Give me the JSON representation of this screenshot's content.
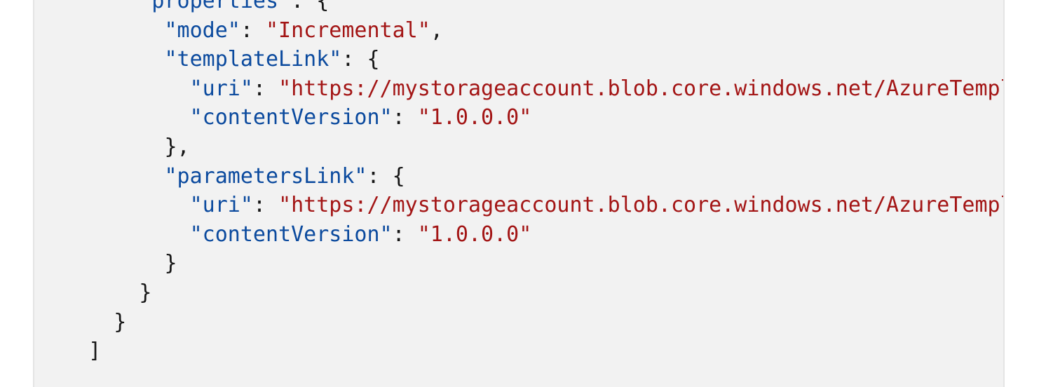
{
  "code": {
    "language": "json",
    "lines": [
      {
        "indent": "      ",
        "tokens": [
          {
            "t": "k",
            "v": "\"properties\""
          },
          {
            "t": "p",
            "v": ": {"
          }
        ]
      },
      {
        "indent": "        ",
        "tokens": [
          {
            "t": "k",
            "v": "\"mode\""
          },
          {
            "t": "p",
            "v": ": "
          },
          {
            "t": "s",
            "v": "\"Incremental\""
          },
          {
            "t": "p",
            "v": ","
          }
        ]
      },
      {
        "indent": "        ",
        "tokens": [
          {
            "t": "k",
            "v": "\"templateLink\""
          },
          {
            "t": "p",
            "v": ": {"
          }
        ]
      },
      {
        "indent": "          ",
        "tokens": [
          {
            "t": "k",
            "v": "\"uri\""
          },
          {
            "t": "p",
            "v": ": "
          },
          {
            "t": "s",
            "v": "\"https://mystorageaccount.blob.core.windows.net/AzureTempl"
          }
        ]
      },
      {
        "indent": "          ",
        "tokens": [
          {
            "t": "k",
            "v": "\"contentVersion\""
          },
          {
            "t": "p",
            "v": ": "
          },
          {
            "t": "s",
            "v": "\"1.0.0.0\""
          }
        ]
      },
      {
        "indent": "        ",
        "tokens": [
          {
            "t": "p",
            "v": "},"
          }
        ]
      },
      {
        "indent": "        ",
        "tokens": [
          {
            "t": "k",
            "v": "\"parametersLink\""
          },
          {
            "t": "p",
            "v": ": {"
          }
        ]
      },
      {
        "indent": "          ",
        "tokens": [
          {
            "t": "k",
            "v": "\"uri\""
          },
          {
            "t": "p",
            "v": ": "
          },
          {
            "t": "s",
            "v": "\"https://mystorageaccount.blob.core.windows.net/AzureTempl"
          }
        ]
      },
      {
        "indent": "          ",
        "tokens": [
          {
            "t": "k",
            "v": "\"contentVersion\""
          },
          {
            "t": "p",
            "v": ": "
          },
          {
            "t": "s",
            "v": "\"1.0.0.0\""
          }
        ]
      },
      {
        "indent": "        ",
        "tokens": [
          {
            "t": "p",
            "v": "}"
          }
        ]
      },
      {
        "indent": "      ",
        "tokens": [
          {
            "t": "p",
            "v": "}"
          }
        ]
      },
      {
        "indent": "    ",
        "tokens": [
          {
            "t": "p",
            "v": "}"
          }
        ]
      },
      {
        "indent": "  ",
        "tokens": [
          {
            "t": "p",
            "v": "]"
          }
        ]
      }
    ]
  }
}
